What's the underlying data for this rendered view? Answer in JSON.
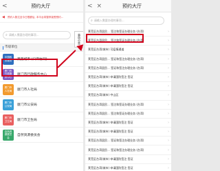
{
  "left": {
    "nav_back": "<",
    "title": "预约大厅",
    "notice": "预约人数达至今日限额后, 本平台将暂停接受预约...",
    "search_placeholder": "请输入需要办理的事项...",
    "group_label": "市级单位",
    "side_tab": "事项分类",
    "departments": [
      {
        "badge": "中国政务服务",
        "name": "莱芜城市 (口岸协同)",
        "color": "#2f6fbf"
      },
      {
        "badge": "厦门市行政服务中心",
        "name": "厦门市行政服务中心",
        "color": "#7c5cc4"
      },
      {
        "badge": "厦门市人社局",
        "name": "厦门市人社局",
        "color": "#f29a2e"
      },
      {
        "badge": "厦门市公安局",
        "name": "厦门市公安局",
        "color": "#3aa0d8"
      },
      {
        "badge": "厦门市卫生局",
        "name": "厦门市卫生局",
        "color": "#e95f5f"
      },
      {
        "badge": "自然资源委员会",
        "name": "自然资源委员会",
        "color": "#38a86b"
      }
    ]
  },
  "right": {
    "nav_back": "<",
    "nav_close": "×",
    "title": "预约大厅",
    "search_placeholder": "请输入需要办理的事项...",
    "items": [
      "莱芜区台湾居民... 签注和签证办理业务 (台湾)",
      "莱芜区台湾居民... 签注和签证办理业务 (台湾)",
      "莱芜区台湾(城市) 可疫情通道",
      "莱芜区台湾居民... 签证和签注办理业务 (台湾)",
      "莱芜区台湾居民... 签证和签注办理业务 (台湾)",
      "莱芜区台湾(城市) 申请国防签注 签证",
      "莱芜区台湾(城市) 申请国防签注 签证",
      "莱芜区台湾(城市) 中山区",
      "莱芜区台湾居民... 签注和签证办理业务 (台湾)",
      "莱芜区台湾居民... 签注和签证办理业务 (台湾)",
      "莱芜区台湾(城市) 申请国防签注 签证",
      "莱芜区台湾(城市) 申请国防签注 签证",
      "莱芜区台湾居民... 签证和签注办理业务 (台湾)",
      "莱芜区台湾居民... 签证和签注办理业务 (台湾)",
      "莱芜区台湾(城市) 申请国防签注 签证",
      "莱芜区台湾(城市) 申请国防签注 签证"
    ]
  }
}
